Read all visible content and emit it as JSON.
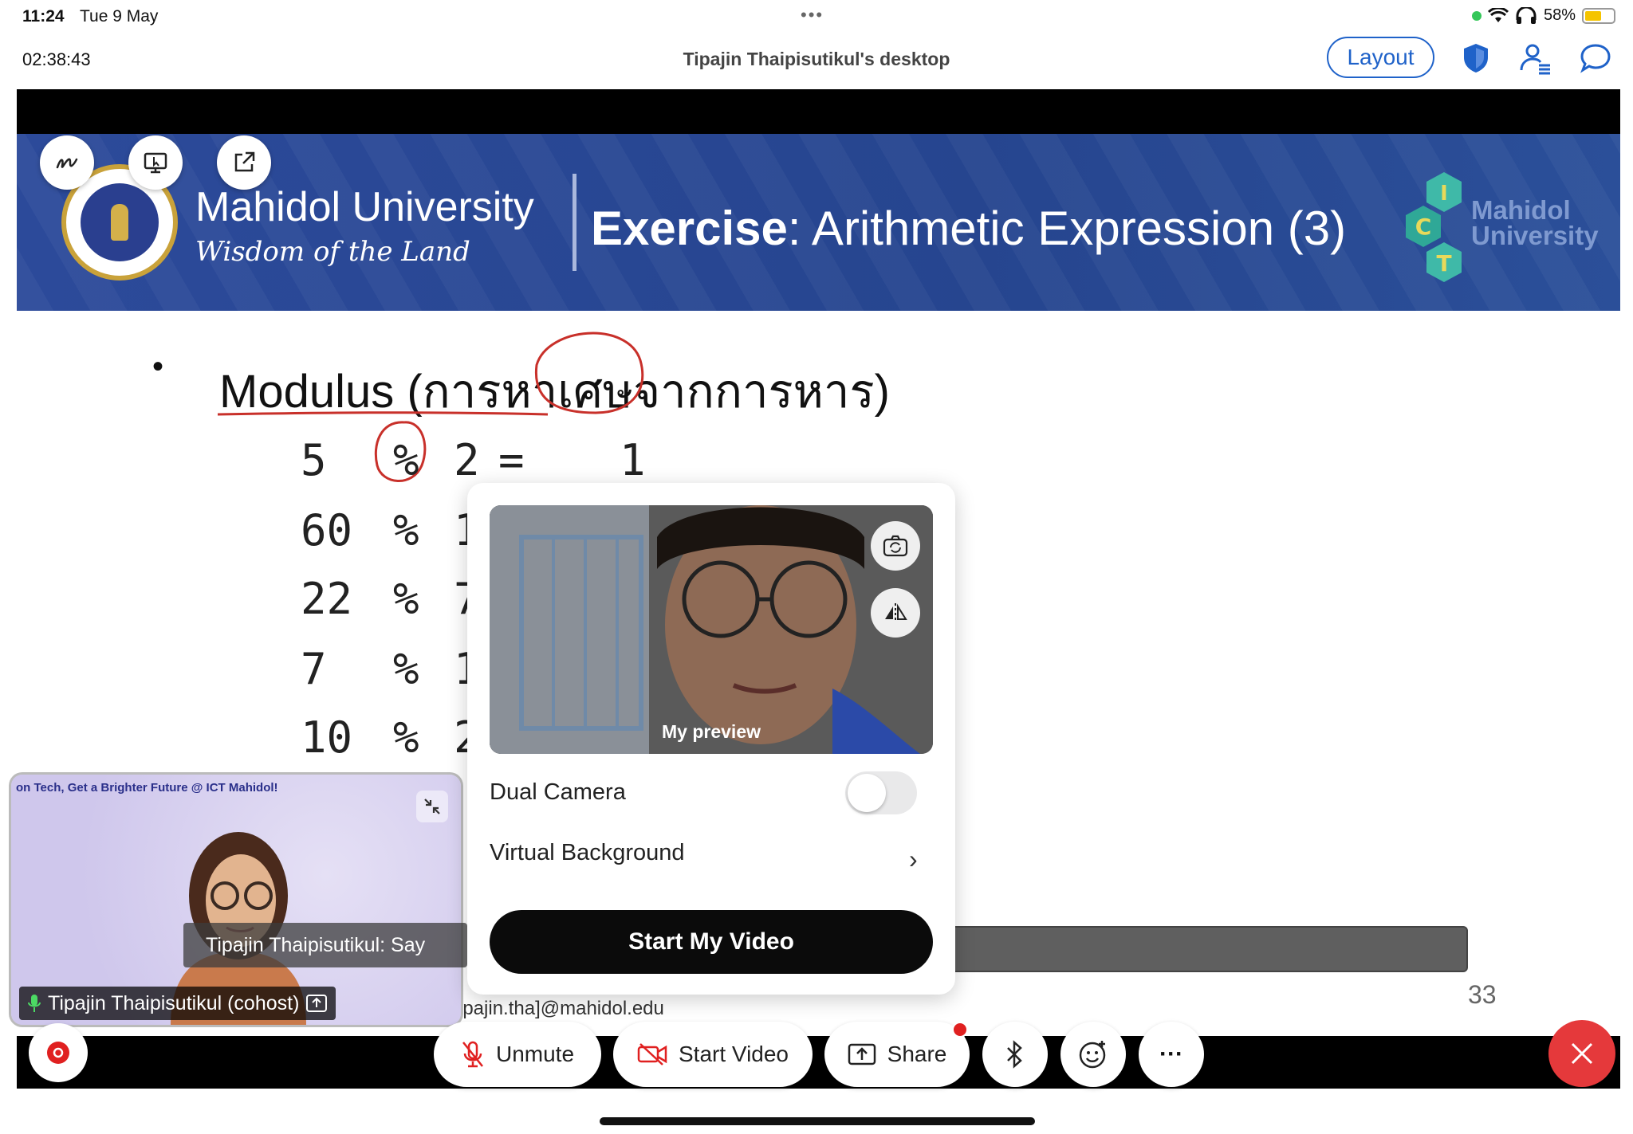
{
  "status_bar": {
    "time": "11:24",
    "date": "Tue 9 May",
    "battery": "58%",
    "battery_level": 0.58,
    "icons": [
      "green-dot",
      "wifi-icon",
      "headphones-icon",
      "battery-icon"
    ]
  },
  "top_bar": {
    "timer": "02:38:43",
    "title": "Tipajin Thaipisutikul's desktop",
    "layout_label": "Layout",
    "icons": [
      "shield-icon",
      "participants-icon",
      "chat-icon"
    ]
  },
  "annotation_tools": [
    "annotate-icon",
    "remote-control-icon",
    "share-out-icon"
  ],
  "slide": {
    "university_name": "Mahidol University",
    "motto": "Wisdom of the Land",
    "title_bold": "Exercise",
    "title_rest": ": Arithmetic Expression (3)",
    "ict_letters": [
      "I",
      "C",
      "T"
    ],
    "ict_text_line1": "Mahidol",
    "ict_text_line2": "University",
    "bullet": "•",
    "heading": "Modulus (การหาเศษจากการหาร)",
    "expressions": [
      {
        "left": "5",
        "op": "%",
        "right": "2",
        "eq": "=",
        "result": "1"
      },
      {
        "left": "60",
        "op": "%",
        "right": "1"
      },
      {
        "left": "22",
        "op": "%",
        "right": "7"
      },
      {
        "left": "7",
        "op": "%",
        "right": "1"
      },
      {
        "left": "10",
        "op": "%",
        "right": "2"
      }
    ],
    "page_number": "33",
    "email_fragment": "ipajin.tha]@mahidol.edu"
  },
  "participant": {
    "banner": "on Tech, Get a Brighter Future @ ICT Mahidol!",
    "name": "Tipajin Thaipisutikul (cohost)",
    "caption": "Tipajin Thaipisutikul: Say"
  },
  "video_popover": {
    "preview_label": "My preview",
    "dual_camera_label": "Dual Camera",
    "dual_camera_on": false,
    "virtual_bg_label": "Virtual Background",
    "start_label": "Start My Video"
  },
  "bottom_bar": {
    "unmute_label": "Unmute",
    "start_video_label": "Start Video",
    "share_label": "Share",
    "more_label": "···"
  },
  "colors": {
    "accent": "#1f62c9",
    "banner": "#2c4a9a",
    "end_red": "#e5393b",
    "ink_red": "#c8302a",
    "black": "#0b0b0b"
  }
}
